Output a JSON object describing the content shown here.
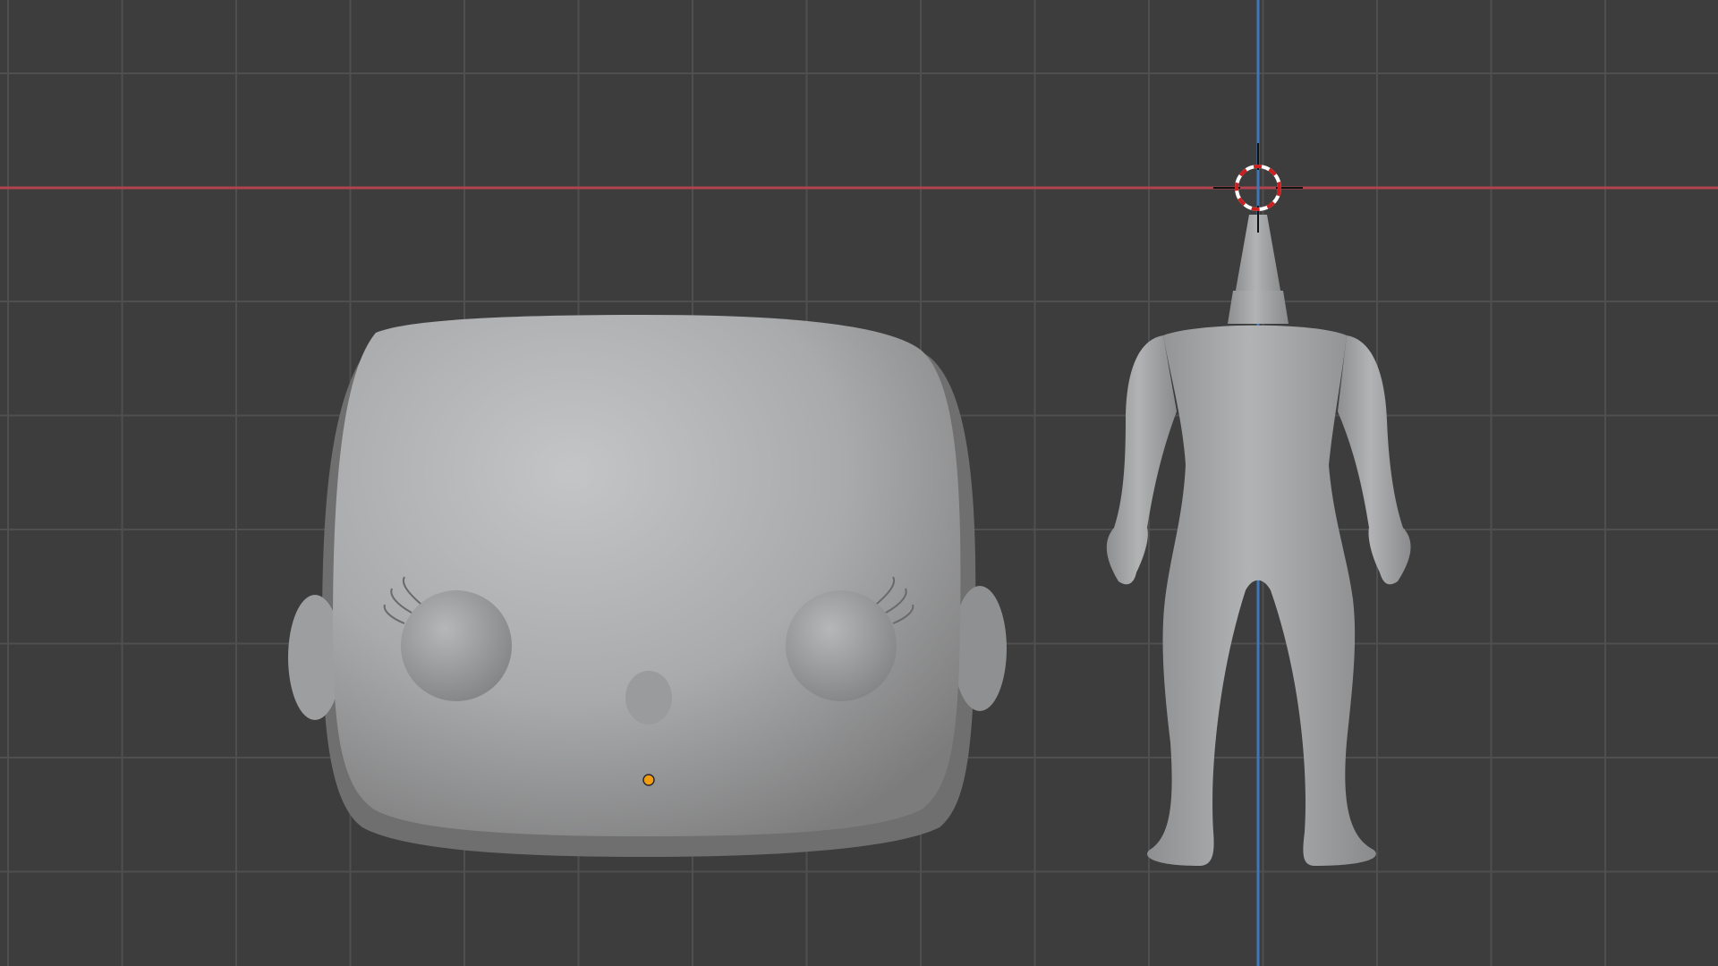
{
  "viewport": {
    "background": "#3d3d3d",
    "grid_color": "#4e4e4e",
    "x_axis_color": "#b0434d",
    "z_axis_color": "#3f77b8",
    "mesh_color": "#a7a7a7",
    "origin_color": "#f39c12",
    "cursor_colors": [
      "#cc2020",
      "#ffffff"
    ]
  },
  "objects": [
    {
      "name": "head",
      "type": "mesh",
      "selected": false,
      "has_origin_marker": true
    },
    {
      "name": "body",
      "type": "mesh",
      "selected": false,
      "has_origin_marker": false
    }
  ],
  "cursor": {
    "name": "3d-cursor",
    "icon": "crosshair-icon"
  }
}
